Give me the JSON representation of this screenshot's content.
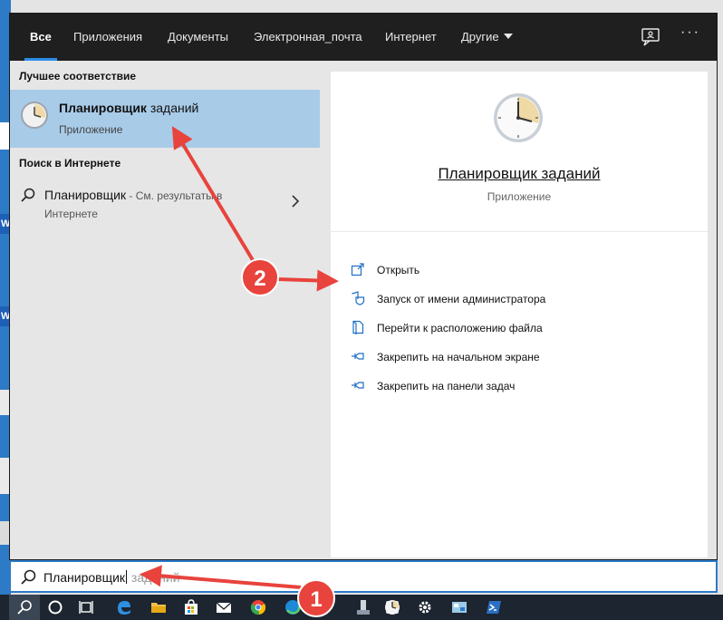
{
  "tabs": [
    {
      "label": "Все",
      "active": true
    },
    {
      "label": "Приложения"
    },
    {
      "label": "Документы"
    },
    {
      "label": "Электронная_почта"
    },
    {
      "label": "Интернет"
    },
    {
      "label": "Другие"
    }
  ],
  "header_icons": {
    "feedback": "feedback-icon",
    "more": "···"
  },
  "left": {
    "best_match_heading": "Лучшее соответствие",
    "best_match": {
      "title_bold": "Планировщик",
      "title_rest": " заданий",
      "subtitle": "Приложение",
      "icon": "clock-icon"
    },
    "web_heading": "Поиск в Интернете",
    "web_item": {
      "query": "Планировщик",
      "hint_line1": " - См. результаты в",
      "hint_line2": "Интернете",
      "icon": "search-icon"
    }
  },
  "preview": {
    "title": "Планировщик заданий",
    "subtitle": "Приложение",
    "icon": "clock-icon",
    "actions": [
      {
        "label": "Открыть",
        "icon": "open-icon"
      },
      {
        "label": "Запуск от имени администратора",
        "icon": "shield-icon"
      },
      {
        "label": "Перейти к расположению файла",
        "icon": "file-location-icon"
      },
      {
        "label": "Закрепить на начальном экране",
        "icon": "pin-icon"
      },
      {
        "label": "Закрепить на панели задач",
        "icon": "pin-icon"
      }
    ]
  },
  "search": {
    "typed": "Планировщик",
    "suggestion": " заданий"
  },
  "annotations": {
    "badge_1": "1",
    "badge_2": "2"
  },
  "colors": {
    "accent": "#2d7ac6",
    "selected": "#a8cbe8",
    "header_bg": "#1f1f1f",
    "taskbar": "#1c2530",
    "badge": "#e8433c"
  },
  "taskbar_icons": [
    "search-icon",
    "cortana-icon",
    "task-view-icon",
    "edge-icon",
    "file-explorer-icon",
    "store-icon",
    "mail-icon",
    "chrome-icon",
    "edge-chromium-icon",
    "app-icon",
    "device-icon",
    "clock-icon",
    "settings-icon",
    "network-app-icon",
    "powershell-icon"
  ]
}
